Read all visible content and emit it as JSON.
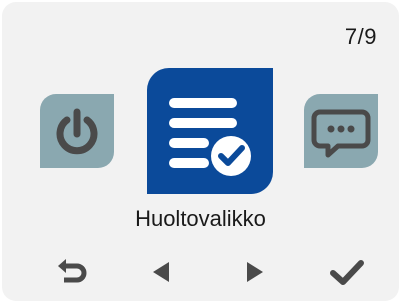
{
  "header": {
    "page_counter": "7/9"
  },
  "carousel": {
    "left_item": {
      "icon": "power-icon"
    },
    "selected_item": {
      "icon": "service-list-check-icon",
      "label": "Huoltovalikko"
    },
    "right_item": {
      "icon": "chat-bubble-icon"
    }
  },
  "softkeys": {
    "back": {
      "icon": "back-arrow-icon"
    },
    "prev": {
      "icon": "triangle-left-icon"
    },
    "next": {
      "icon": "triangle-right-icon"
    },
    "ok": {
      "icon": "checkmark-icon"
    }
  },
  "colors": {
    "background": "#f2f2f2",
    "selected_tile": "#0b4a9a",
    "side_tile": "#8aa8b0",
    "icon_dark": "#4a4a4a",
    "text": "#1a1a1a"
  }
}
